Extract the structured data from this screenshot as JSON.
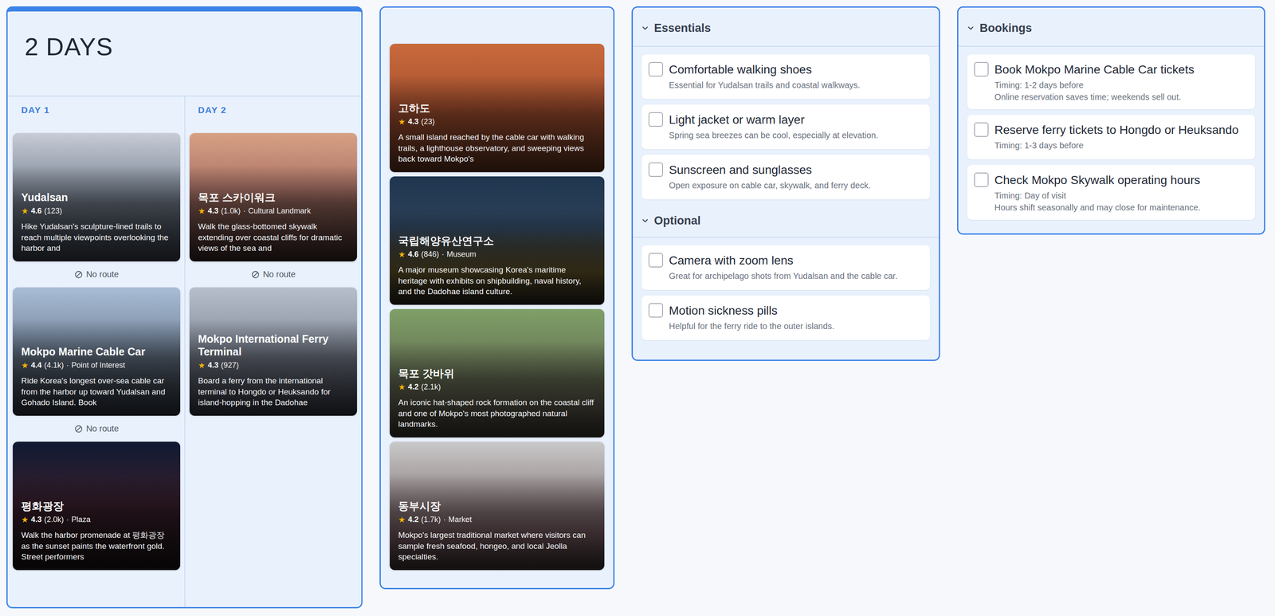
{
  "itinerary": {
    "title": "2 DAYS",
    "days": [
      {
        "label": "DAY 1",
        "stops": [
          {
            "name": "Yudalsan",
            "rating": "4.6",
            "count": "(123)",
            "description": "Hike Yudalsan's sculpture-lined trails to reach multiple viewpoints overlooking the harbor and",
            "route": "No route"
          },
          {
            "name": "Mokpo Marine Cable Car",
            "rating": "4.4",
            "count": "(4.1k)",
            "category": "Point of Interest",
            "description": "Ride Korea's longest over-sea cable car from the harbor up toward Yudalsan and Gohado Island. Book",
            "route": "No route"
          },
          {
            "name": "평화광장",
            "rating": "4.3",
            "count": "(2.0k)",
            "category": "Plaza",
            "description": "Walk the harbor promenade at 평화광장 as the sunset paints the waterfront gold. Street performers"
          }
        ]
      },
      {
        "label": "DAY 2",
        "stops": [
          {
            "name": "목포 스카이워크",
            "rating": "4.3",
            "count": "(1.0k)",
            "category": "Cultural Landmark",
            "description": "Walk the glass-bottomed skywalk extending over coastal cliffs for dramatic views of the sea and",
            "route": "No route"
          },
          {
            "name": "Mokpo International Ferry Terminal",
            "rating": "4.3",
            "count": "(927)",
            "description": "Board a ferry from the international terminal to Hongdo or Heuksando for island-hopping in the Dadohae"
          }
        ]
      }
    ]
  },
  "rating_icon": "★",
  "meta_separator": "·",
  "suggestions": [
    {
      "name": "고하도",
      "rating": "4.3",
      "count": "(23)",
      "description": "A small island reached by the cable car with walking trails, a lighthouse observatory, and sweeping views back toward Mokpo's"
    },
    {
      "name": "국립해양유산연구소",
      "rating": "4.6",
      "count": "(846)",
      "category": "Museum",
      "description": "A major museum showcasing Korea's maritime heritage with exhibits on shipbuilding, naval history, and the Dadohae island culture."
    },
    {
      "name": "목포 갓바위",
      "rating": "4.2",
      "count": "(2.1k)",
      "description": "An iconic hat-shaped rock formation on the coastal cliff and one of Mokpo's most photographed natural landmarks."
    },
    {
      "name": "동부시장",
      "rating": "4.2",
      "count": "(1.7k)",
      "category": "Market",
      "description": "Mokpo's largest traditional market where visitors can sample fresh seafood, hongeo, and local Jeolla specialties."
    }
  ],
  "checklist": {
    "sections": [
      {
        "title": "Essentials",
        "expanded": true,
        "items": [
          {
            "title": "Comfortable walking shoes",
            "note": "Essential for Yudalsan trails and coastal walkways.",
            "checked": false
          },
          {
            "title": "Light jacket or warm layer",
            "note": "Spring sea breezes can be cool, especially at elevation.",
            "checked": false
          },
          {
            "title": "Sunscreen and sunglasses",
            "note": "Open exposure on cable car, skywalk, and ferry deck.",
            "checked": false
          }
        ]
      },
      {
        "title": "Optional",
        "expanded": true,
        "items": [
          {
            "title": "Camera with zoom lens",
            "note": "Great for archipelago shots from Yudalsan and the cable car.",
            "checked": false
          },
          {
            "title": "Motion sickness pills",
            "note": "Helpful for the ferry ride to the outer islands.",
            "checked": false
          }
        ]
      }
    ]
  },
  "bookings": {
    "title": "Bookings",
    "expanded": true,
    "items": [
      {
        "title": "Book Mokpo Marine Cable Car tickets",
        "timing": "Timing: 1-2 days before",
        "note": "Online reservation saves time; weekends sell out.",
        "checked": false
      },
      {
        "title": "Reserve ferry tickets to Hongdo or Heuksando",
        "timing": "Timing: 1-3 days before",
        "checked": false
      },
      {
        "title": "Check Mokpo Skywalk operating hours",
        "timing": "Timing: Day of visit",
        "note": "Hours shift seasonally and may close for maintenance.",
        "checked": false
      }
    ]
  }
}
